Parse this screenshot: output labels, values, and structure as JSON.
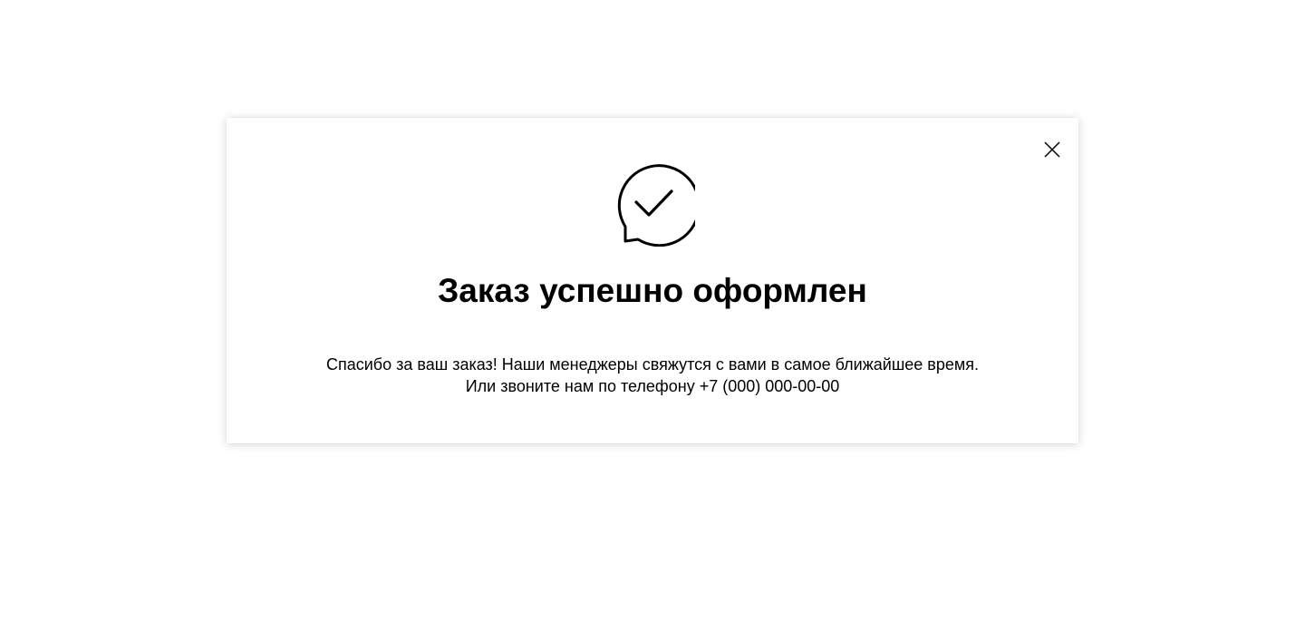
{
  "modal": {
    "title": "Заказ успешно оформлен",
    "message_line1": "Спасибо за ваш заказ! Наши менеджеры свяжутся с вами в самое ближайшее время.",
    "message_line2": "Или звоните нам по телефону +7 (000) 000-00-00",
    "icons": {
      "close": "close-icon",
      "success": "chat-bubble-check-icon"
    }
  },
  "colors": {
    "background": "#ffffff",
    "text": "#000000"
  }
}
